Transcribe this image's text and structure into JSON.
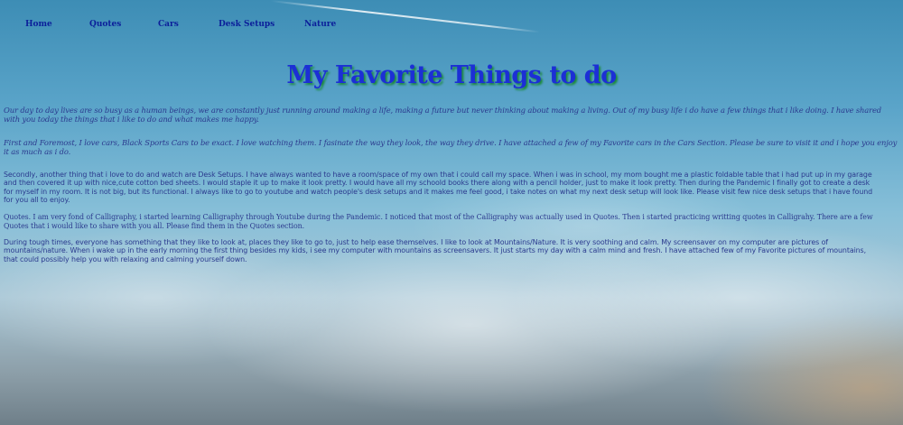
{
  "nav": {
    "items": [
      {
        "label": "Home"
      },
      {
        "label": "Quotes"
      },
      {
        "label": "Cars"
      },
      {
        "label": "Desk Setups"
      },
      {
        "label": "Nature"
      }
    ]
  },
  "page": {
    "title": "My Favorite Things to do"
  },
  "paragraphs": {
    "intro": "Our day to day lives are so busy as a human beings, we are constantly just running around making a life, making a future but never thinking about making a living. Out of my busy life i do have a few things that i like doing. I have shared with you today the things that i like to do and what makes me happy.",
    "cars": "First and Foremost, I love cars, Black Sports Cars to be exact. I love watching them. I fasinate the way they look, the way they drive. I have attached a few of my Favorite cars in the Cars Section. Please be sure to visit it and i hope you enjoy it as much as i do.",
    "desk": "Secondly, another thing that i love to do and watch are Desk Setups. I have always wanted to have a room/space of my own that i could call my space. When i was in school, my mom bought me a plastic foldable table that i had put up in my garage and then covered it up with nice,cute cotton bed sheets. I would staple it up to make it look pretty. I would have all my schoold books there along with a pencil holder, just to make it look pretty. Then during the Pandemic I finally got to create a desk for myself in my room. It is not big, but its functional. I always like to go to youtube and watch people's desk setups and it makes me feel good, i take notes on what my next desk setup will look like. Please visit few nice desk setups that i have found for you all to enjoy.",
    "quotes": "Quotes. I am very fond of Calligraphy, i started learning Calligraphy through Youtube during the Pandemic. I noticed that most of the Calligraphy was actually used in Quotes. Then i started practicing writting quotes in Calligrahy. There are a few Quotes that i would like to share with you all. Please find them in the Quotes section.",
    "nature": "During tough times, everyone has something that they like to look at, places they like to go to, just to help ease themselves. I like to look at Mountains/Nature. It is very soothing and calm. My screensaver on my computer are pictures of mountains/nature. When i wake up in the early morning the first thing besides my kids, i see my computer with mountains as screensavers. It just starts my day with a calm mind and fresh. I have attached few of my Favorite pictures of mountains, that could possibly help you with relaxing and calming yourself down."
  },
  "colors": {
    "nav_link": "#0b1f9a",
    "title": "#1c2fd6",
    "title_shadow": "#1d8a3c",
    "body_text": "#2b3a8e"
  }
}
